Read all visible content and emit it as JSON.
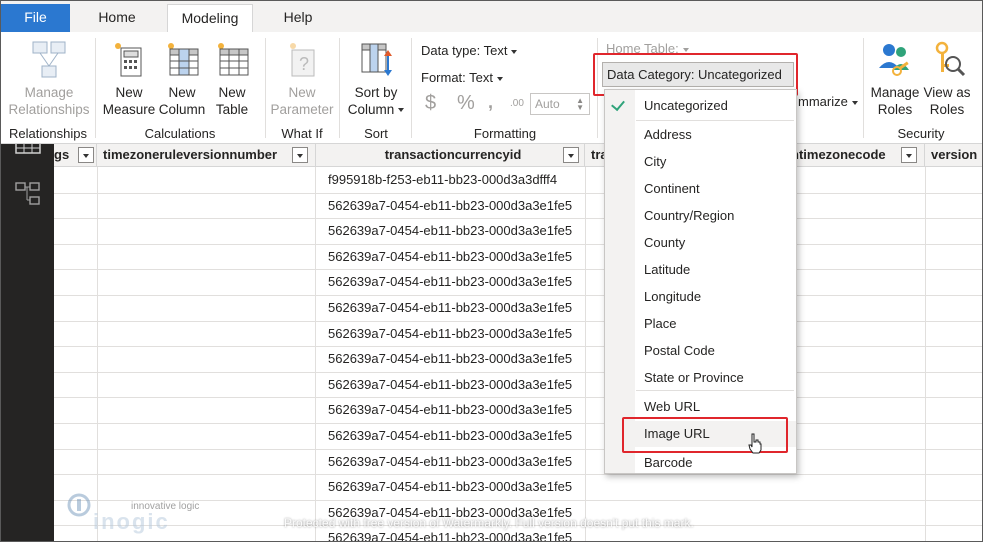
{
  "tabs": {
    "file": "File",
    "home": "Home",
    "modeling": "Modeling",
    "help": "Help"
  },
  "ribbon": {
    "manage_relationships": [
      "Manage",
      "Relationships"
    ],
    "new_measure": [
      "New",
      "Measure"
    ],
    "new_column": [
      "New",
      "Column"
    ],
    "new_table": [
      "New",
      "Table"
    ],
    "new_parameter": [
      "New",
      "Parameter"
    ],
    "sort_by_column": [
      "Sort by",
      "Column"
    ],
    "data_type": "Data type: Text",
    "format": "Format: Text",
    "currency_symbol": "$",
    "percent_symbol": "%",
    "comma_symbol": "̸",
    "decimal_symbol": ".00",
    "auto_value": "Auto",
    "home_table": "Home Table:",
    "data_category": "Data Category: Uncategorized",
    "summarize_partial": "mmarize",
    "manage_roles": [
      "Manage",
      "Roles"
    ],
    "view_as_roles": [
      "View as",
      "Roles"
    ],
    "groups": {
      "relationships": "Relationships",
      "calculations": "Calculations",
      "what_if": "What If",
      "sort": "Sort",
      "formatting": "Formatting",
      "security": "Security"
    }
  },
  "table": {
    "columns": [
      "gs",
      "timezoneruleversionnumber",
      "transactioncurrencyid",
      "tra",
      "ntimezonecode",
      "version"
    ],
    "rows": [
      "f995918b-f253-eb11-bb23-000d3a3dfff4",
      "562639a7-0454-eb11-bb23-000d3a3e1fe5",
      "562639a7-0454-eb11-bb23-000d3a3e1fe5",
      "562639a7-0454-eb11-bb23-000d3a3e1fe5",
      "562639a7-0454-eb11-bb23-000d3a3e1fe5",
      "562639a7-0454-eb11-bb23-000d3a3e1fe5",
      "562639a7-0454-eb11-bb23-000d3a3e1fe5",
      "562639a7-0454-eb11-bb23-000d3a3e1fe5",
      "562639a7-0454-eb11-bb23-000d3a3e1fe5",
      "562639a7-0454-eb11-bb23-000d3a3e1fe5",
      "562639a7-0454-eb11-bb23-000d3a3e1fe5",
      "562639a7-0454-eb11-bb23-000d3a3e1fe5",
      "562639a7-0454-eb11-bb23-000d3a3e1fe5",
      "562639a7-0454-eb11-bb23-000d3a3e1fe5",
      "562639a7-0454-eb11-bb23-000d3a3e1fe5"
    ]
  },
  "menu": {
    "items": [
      "Uncategorized",
      "Address",
      "City",
      "Continent",
      "Country/Region",
      "County",
      "Latitude",
      "Longitude",
      "Place",
      "Postal Code",
      "State or Province",
      "Web URL",
      "Image URL",
      "Barcode"
    ],
    "checked": "Uncategorized",
    "hovered": "Image URL"
  },
  "watermark": "Protected with free version of Watermarkly. Full version doesn't put this mark.",
  "logo": {
    "tagline": "innovative logic",
    "name": "inogic"
  },
  "colors": {
    "file_tab": "#2b78d0",
    "highlight": "#e0262c",
    "check": "#2fa37a",
    "rail": "#252423"
  }
}
